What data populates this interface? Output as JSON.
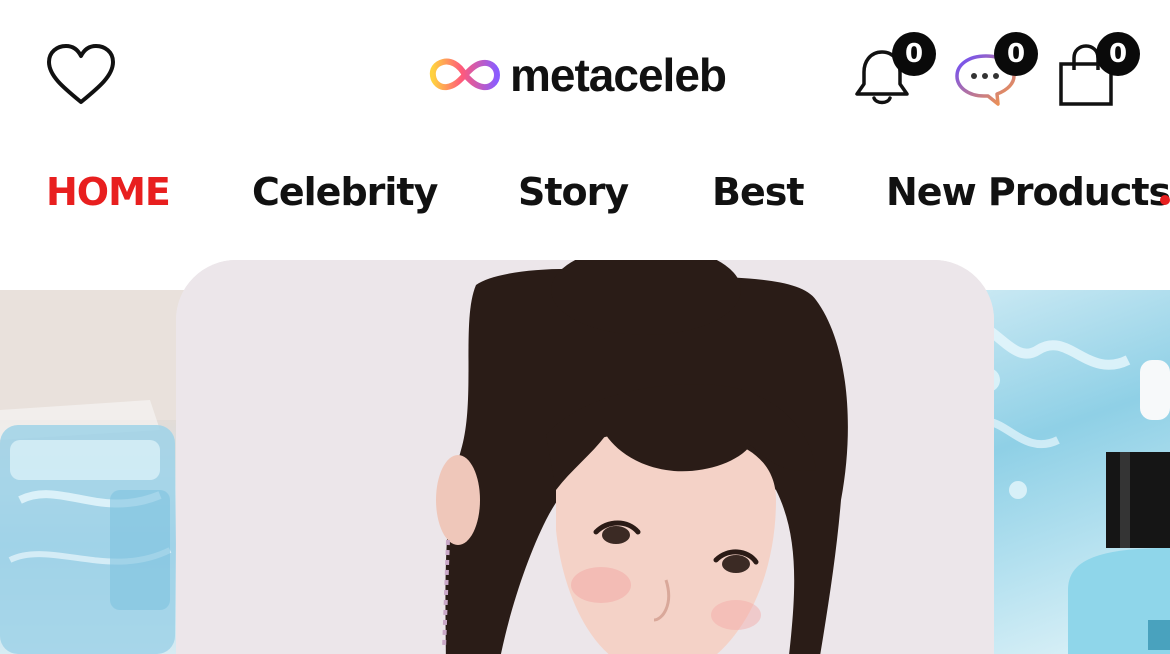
{
  "header": {
    "logo_text": "metaceleb",
    "icons": {
      "wishlist": "heart-icon",
      "notifications": "bell-icon",
      "messages": "chat-bubble-icon",
      "cart": "shopping-bag-icon"
    },
    "notification_count": "0",
    "message_count": "0",
    "cart_count": "0"
  },
  "nav": {
    "items": [
      {
        "label": "HOME",
        "active": true
      },
      {
        "label": "Celebrity",
        "active": false
      },
      {
        "label": "Story",
        "active": false
      },
      {
        "label": "Best",
        "active": false
      },
      {
        "label": "New Products",
        "active": false
      }
    ]
  },
  "banner": {
    "slides": [
      "previous-slide-water-product",
      "current-slide-celebrity-portrait",
      "next-slide-serum-bottle"
    ]
  },
  "colors": {
    "active_nav": "#e81f1f",
    "badge_bg": "#0a0a0a",
    "logo_gradient": [
      "#ffd23f",
      "#ff5a7a",
      "#8a5cff"
    ]
  }
}
